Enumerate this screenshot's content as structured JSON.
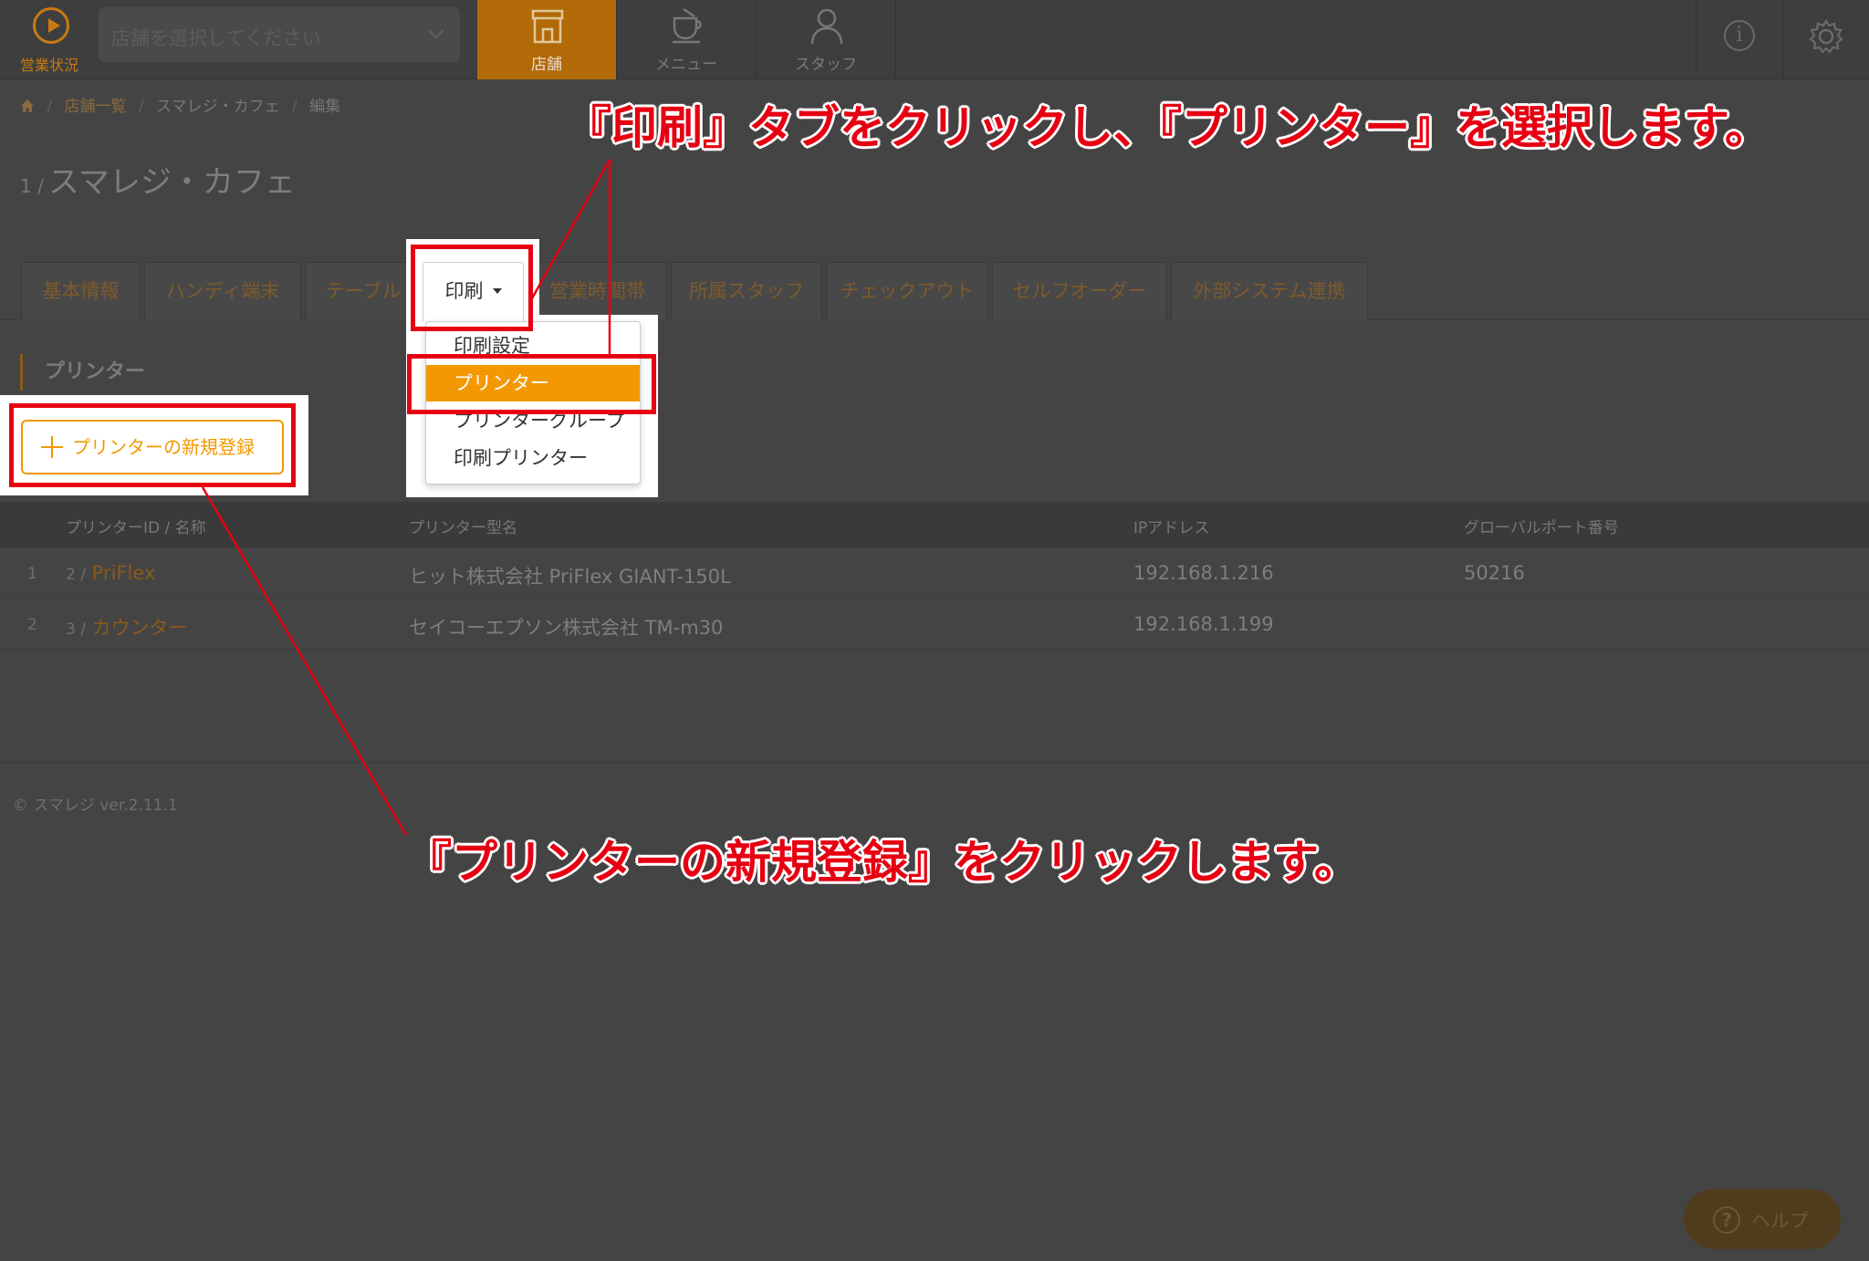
{
  "header": {
    "status_label": "営業状況",
    "store_select_placeholder": "店舗を選択してください",
    "nav": [
      {
        "label": "店舗",
        "icon": "store-icon",
        "active": true
      },
      {
        "label": "メニュー",
        "icon": "menu-icon",
        "active": false
      },
      {
        "label": "スタッフ",
        "icon": "staff-icon",
        "active": false
      }
    ],
    "info_glyph": "i"
  },
  "breadcrumb": [
    "店舗一覧",
    "スマレジ・カフェ",
    "編集"
  ],
  "page": {
    "number": "1 /",
    "title": "スマレジ・カフェ"
  },
  "tabs": [
    "基本情報",
    "ハンディ端末",
    "テーブル",
    "印刷",
    "営業時間帯",
    "所属スタッフ",
    "チェックアウト",
    "セルフオーダー",
    "外部システム連携"
  ],
  "print_dropdown": {
    "items": [
      "印刷設定",
      "プリンター",
      "プリンターグループ",
      "印刷プリンター"
    ],
    "selected": "プリンター"
  },
  "section": {
    "title": "プリンター",
    "add_button": "プリンターの新規登録"
  },
  "table": {
    "headers": [
      "プリンターID / 名称",
      "プリンター型名",
      "IPアドレス",
      "グローバルポート番号"
    ],
    "rows": [
      {
        "index": "1",
        "id": "2 /",
        "name": "PriFlex",
        "model": "ヒット株式会社 PriFlex GIANT-150L",
        "ip": "192.168.1.216",
        "port": "50216"
      },
      {
        "index": "2",
        "id": "3 /",
        "name": "カウンター",
        "model": "セイコーエプソン株式会社 TM-m30",
        "ip": "192.168.1.199",
        "port": ""
      }
    ]
  },
  "footer": "© スマレジ ver.2.11.1",
  "help_label": "ヘルプ",
  "annotations": {
    "top": "『印刷』タブをクリックし、『プリンター』を選択します。",
    "bottom": "『プリンターの新規登録』をクリックします。"
  },
  "colors": {
    "accent": "#f39800",
    "annotation": "#e60012",
    "overlay": "#444444"
  }
}
